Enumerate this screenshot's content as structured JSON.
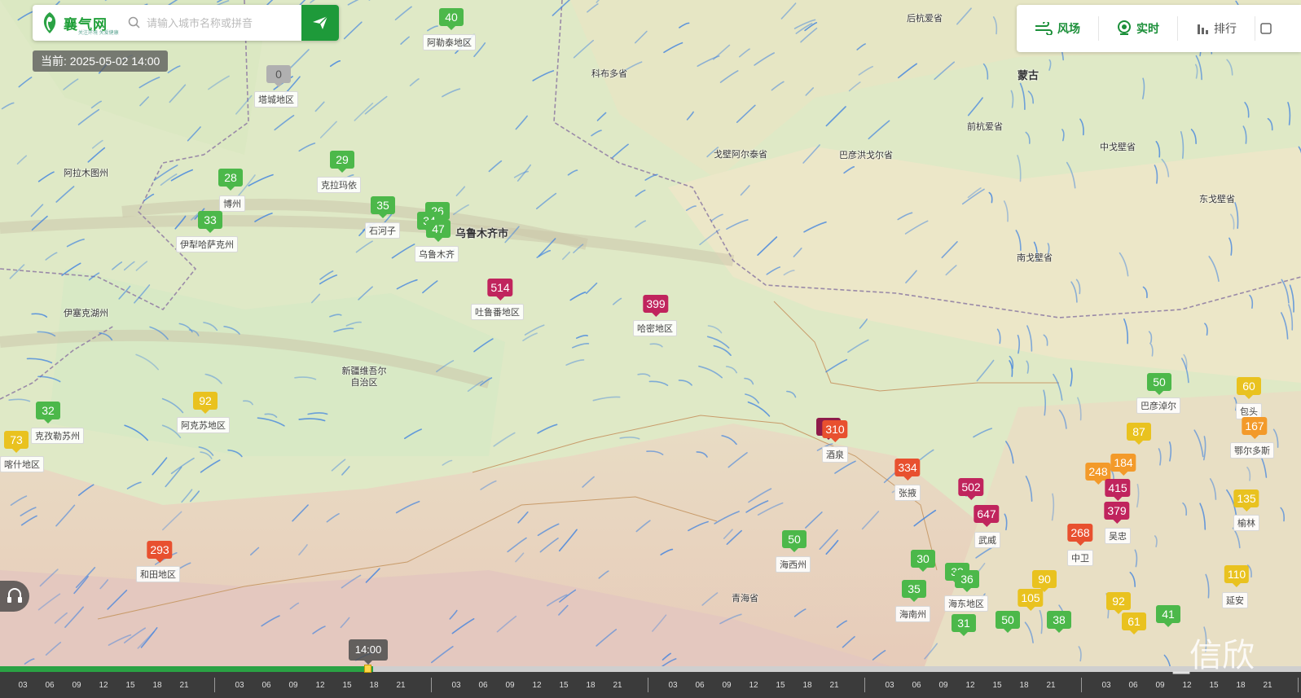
{
  "app": {
    "logo_text": "襄气网",
    "logo_subtitle": "关注环境 关爱健康",
    "logo_icon": "leaf-logo-icon"
  },
  "search": {
    "placeholder": "请输入城市名称或拼音",
    "button_icon": "send-icon"
  },
  "current_time": "当前: 2025-05-02 14:00",
  "toolbar": {
    "items": [
      {
        "label": "风场",
        "icon": "wind-icon",
        "style": "green"
      },
      {
        "label": "实时",
        "icon": "location-pin-icon",
        "style": "green"
      },
      {
        "label": "排行",
        "icon": "bar-chart-icon",
        "style": "grey"
      }
    ]
  },
  "colors": {
    "good": "#4cb84a",
    "moderate": "#e9c21f",
    "unhealthy_sensitive": "#f39a2a",
    "unhealthy": "#e8502f",
    "very_unhealthy": "#c0245d",
    "hazardous": "#8e1b4a",
    "no_data": "#b0b0b0"
  },
  "map_labels": [
    {
      "text": "阿勒泰地区",
      "boxed": true
    },
    {
      "text": "塔城地区",
      "boxed": true
    },
    {
      "text": "克拉玛依",
      "boxed": true
    },
    {
      "text": "博州",
      "boxed": true
    },
    {
      "text": "伊犁哈萨克州",
      "boxed": true
    },
    {
      "text": "石河子",
      "boxed": true
    },
    {
      "text": "乌鲁木齐",
      "boxed": true
    },
    {
      "text": "吐鲁番地区",
      "boxed": true
    },
    {
      "text": "哈密地区",
      "boxed": true
    },
    {
      "text": "阿克苏地区",
      "boxed": true
    },
    {
      "text": "克孜勒苏州",
      "boxed": true
    },
    {
      "text": "喀什地区",
      "boxed": true
    },
    {
      "text": "和田地区",
      "boxed": true
    },
    {
      "text": "海西州",
      "boxed": true
    },
    {
      "text": "海东地区",
      "boxed": true
    },
    {
      "text": "海南州",
      "boxed": true
    },
    {
      "text": "酒泉",
      "boxed": true
    },
    {
      "text": "张掖",
      "boxed": true
    },
    {
      "text": "武威",
      "boxed": true
    },
    {
      "text": "中卫",
      "boxed": true
    },
    {
      "text": "吴忠",
      "boxed": true
    },
    {
      "text": "巴彦淖尔",
      "boxed": true
    },
    {
      "text": "包头",
      "boxed": true
    },
    {
      "text": "鄂尔多斯",
      "boxed": true
    },
    {
      "text": "榆林",
      "boxed": true
    },
    {
      "text": "延安",
      "boxed": true
    },
    {
      "text": "乌鲁木齐市",
      "boxed": false,
      "big": true
    },
    {
      "text": "蒙古",
      "boxed": false,
      "big": true
    },
    {
      "text": "科布多省",
      "boxed": false
    },
    {
      "text": "后杭爱省",
      "boxed": false
    },
    {
      "text": "前杭爱省",
      "boxed": false
    },
    {
      "text": "戈壁阿尔泰省",
      "boxed": false
    },
    {
      "text": "巴彦洪戈尔省",
      "boxed": false
    },
    {
      "text": "中戈壁省",
      "boxed": false
    },
    {
      "text": "东戈壁省",
      "boxed": false
    },
    {
      "text": "南戈壁省",
      "boxed": false
    },
    {
      "text": "阿拉木图州",
      "boxed": false
    },
    {
      "text": "伊塞克湖州",
      "boxed": false
    },
    {
      "text": "新疆维吾尔自治区",
      "boxed": false
    },
    {
      "text": "青海省",
      "boxed": false
    }
  ],
  "aqi_markers": [
    {
      "value": "40",
      "level": "good"
    },
    {
      "value": "0",
      "level": "no_data"
    },
    {
      "value": "29",
      "level": "good"
    },
    {
      "value": "28",
      "level": "good"
    },
    {
      "value": "33",
      "level": "good"
    },
    {
      "value": "35",
      "level": "good"
    },
    {
      "value": "26",
      "level": "good"
    },
    {
      "value": "34",
      "level": "good"
    },
    {
      "value": "47",
      "level": "good"
    },
    {
      "value": "514",
      "level": "very_unhealthy"
    },
    {
      "value": "399",
      "level": "very_unhealthy"
    },
    {
      "value": "92",
      "level": "moderate"
    },
    {
      "value": "32",
      "level": "good"
    },
    {
      "value": "73",
      "level": "moderate"
    },
    {
      "value": "293",
      "level": "unhealthy"
    },
    {
      "value": "4",
      "level": "hazardous"
    },
    {
      "value": "310",
      "level": "unhealthy"
    },
    {
      "value": "334",
      "level": "unhealthy"
    },
    {
      "value": "502",
      "level": "very_unhealthy"
    },
    {
      "value": "647",
      "level": "very_unhealthy"
    },
    {
      "value": "50",
      "level": "good"
    },
    {
      "value": "30",
      "level": "good"
    },
    {
      "value": "33",
      "level": "good"
    },
    {
      "value": "36",
      "level": "good"
    },
    {
      "value": "35",
      "level": "good"
    },
    {
      "value": "31",
      "level": "good"
    },
    {
      "value": "50",
      "level": "good"
    },
    {
      "value": "38",
      "level": "good"
    },
    {
      "value": "90",
      "level": "moderate"
    },
    {
      "value": "105",
      "level": "moderate"
    },
    {
      "value": "268",
      "level": "unhealthy"
    },
    {
      "value": "248",
      "level": "unhealthy_sensitive"
    },
    {
      "value": "184",
      "level": "unhealthy_sensitive"
    },
    {
      "value": "415",
      "level": "very_unhealthy"
    },
    {
      "value": "379",
      "level": "very_unhealthy"
    },
    {
      "value": "87",
      "level": "moderate"
    },
    {
      "value": "50",
      "level": "good"
    },
    {
      "value": "60",
      "level": "moderate"
    },
    {
      "value": "167",
      "level": "unhealthy_sensitive"
    },
    {
      "value": "135",
      "level": "moderate"
    },
    {
      "value": "110",
      "level": "moderate"
    },
    {
      "value": "92",
      "level": "moderate"
    },
    {
      "value": "61",
      "level": "moderate"
    },
    {
      "value": "41",
      "level": "good"
    }
  ],
  "timeline": {
    "current_label": "14:00",
    "progress_fraction": 0.287,
    "hour_ticks": [
      "03",
      "06",
      "09",
      "12",
      "15",
      "18",
      "21"
    ]
  },
  "watermark": "_信欣",
  "left_tool_icon": "headset-icon"
}
